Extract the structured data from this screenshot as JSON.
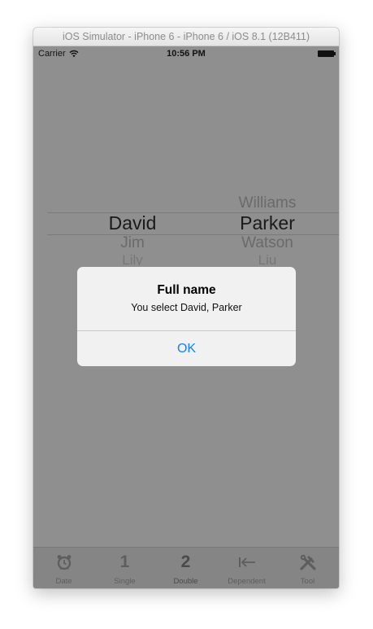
{
  "window": {
    "title": "iOS Simulator - iPhone 6 - iPhone 6 / iOS 8.1 (12B411)"
  },
  "status_bar": {
    "carrier": "Carrier",
    "time": "10:56 PM"
  },
  "picker": {
    "first_names": {
      "selected": "David",
      "below": [
        "Jim",
        "Lily"
      ]
    },
    "last_names": {
      "above": "Williams",
      "selected": "Parker",
      "below": [
        "Watson",
        "Liu"
      ]
    }
  },
  "alert": {
    "title": "Full name",
    "message": "You select David, Parker",
    "ok_label": "OK"
  },
  "tab_bar": {
    "items": [
      {
        "label": "Date",
        "icon": "alarm-clock-icon"
      },
      {
        "label": "Single",
        "icon": "1"
      },
      {
        "label": "Double",
        "icon": "2",
        "selected": true
      },
      {
        "label": "Dependent",
        "icon": "arrow-to-left-icon"
      },
      {
        "label": "Tool",
        "icon": "tools-icon"
      }
    ]
  },
  "colors": {
    "dimmed_background": "#8f8f8f",
    "alert_background": "#f4f4f4",
    "alert_button": "#1a7ef5"
  }
}
